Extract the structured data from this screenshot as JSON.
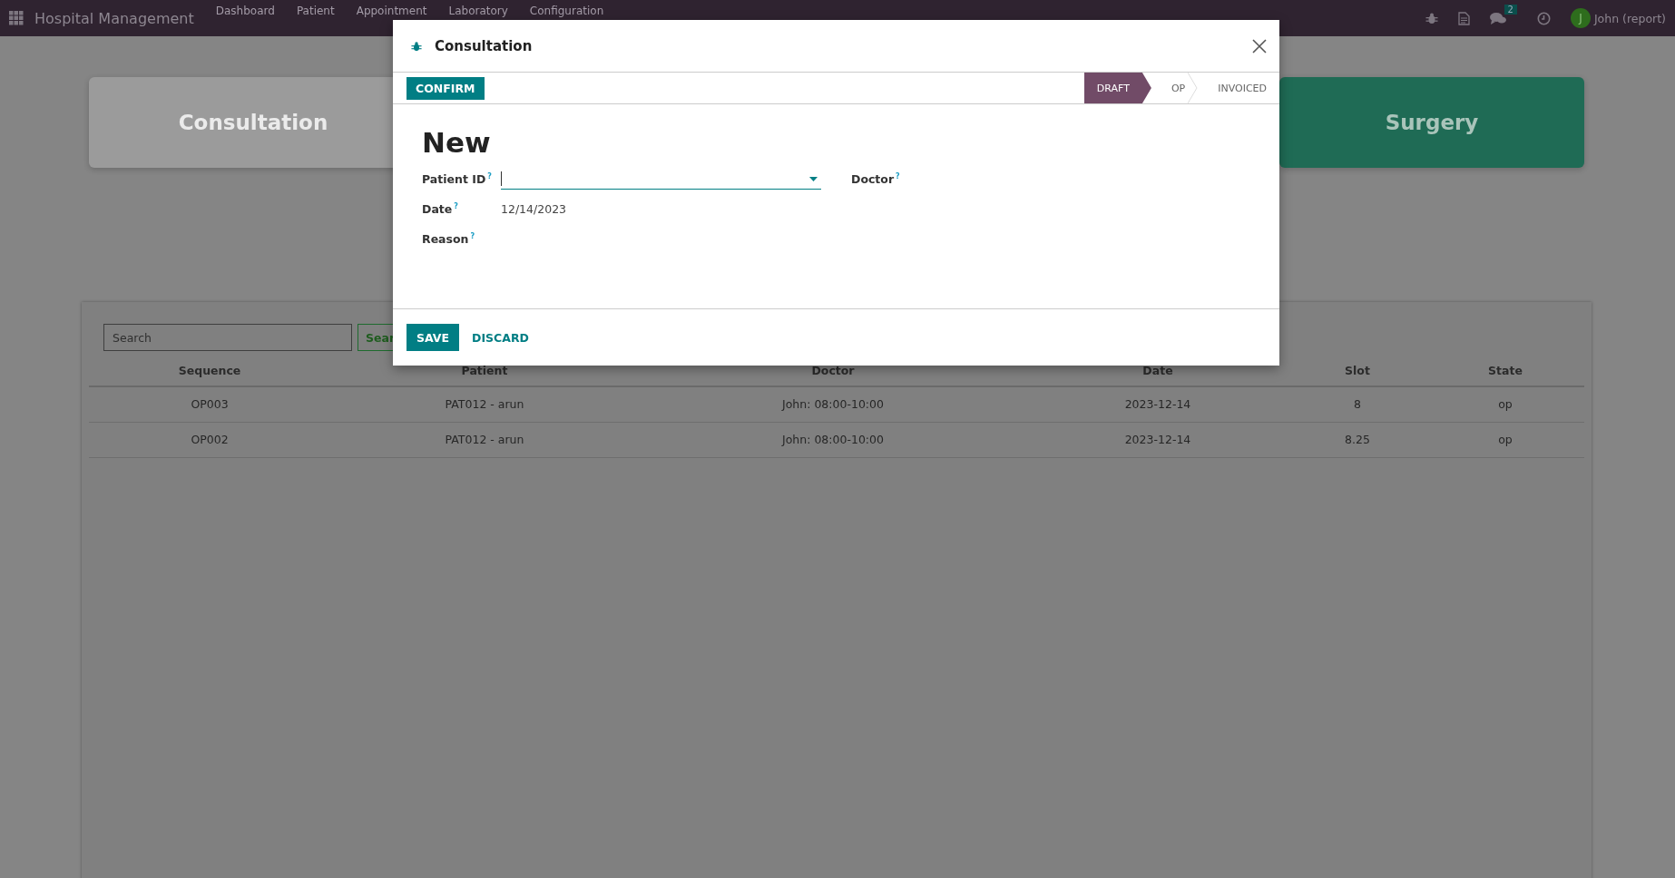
{
  "navbar": {
    "app_name": "Hospital Management",
    "menu": [
      "Dashboard",
      "Patient",
      "Appointment",
      "Laboratory",
      "Configuration"
    ],
    "messages_badge": "2",
    "avatar_initial": "J",
    "user": "John (report)"
  },
  "cards": [
    {
      "label": "Consultation",
      "color": "#9b9b9b"
    },
    {
      "label": "Surgery",
      "color": "#1f6b55"
    }
  ],
  "search": {
    "placeholder": "Search",
    "button": "Sear"
  },
  "table": {
    "columns": [
      "Sequence",
      "Patient",
      "Doctor",
      "Date",
      "Slot",
      "State"
    ],
    "rows": [
      [
        "OP003",
        "PAT012 - arun",
        "John: 08:00-10:00",
        "2023-12-14",
        "8",
        "op"
      ],
      [
        "OP002",
        "PAT012 - arun",
        "John: 08:00-10:00",
        "2023-12-14",
        "8.25",
        "op"
      ]
    ]
  },
  "dialog": {
    "title": "Consultation",
    "confirm": "CONFIRM",
    "stages": [
      {
        "label": "DRAFT",
        "selected": true
      },
      {
        "label": "OP",
        "selected": false
      },
      {
        "label": "INVOICED",
        "selected": false
      }
    ],
    "record_title": "New",
    "left_fields": [
      {
        "label": "Patient ID",
        "help": "?",
        "kind": "dropdown"
      },
      {
        "label": "Date",
        "help": "?",
        "kind": "text",
        "value": "12/14/2023"
      },
      {
        "label": "Reason",
        "help": "?",
        "kind": "empty"
      }
    ],
    "right_fields": [
      {
        "label": "Doctor",
        "help": "?"
      }
    ],
    "save": "SAVE",
    "discard": "DISCARD"
  }
}
